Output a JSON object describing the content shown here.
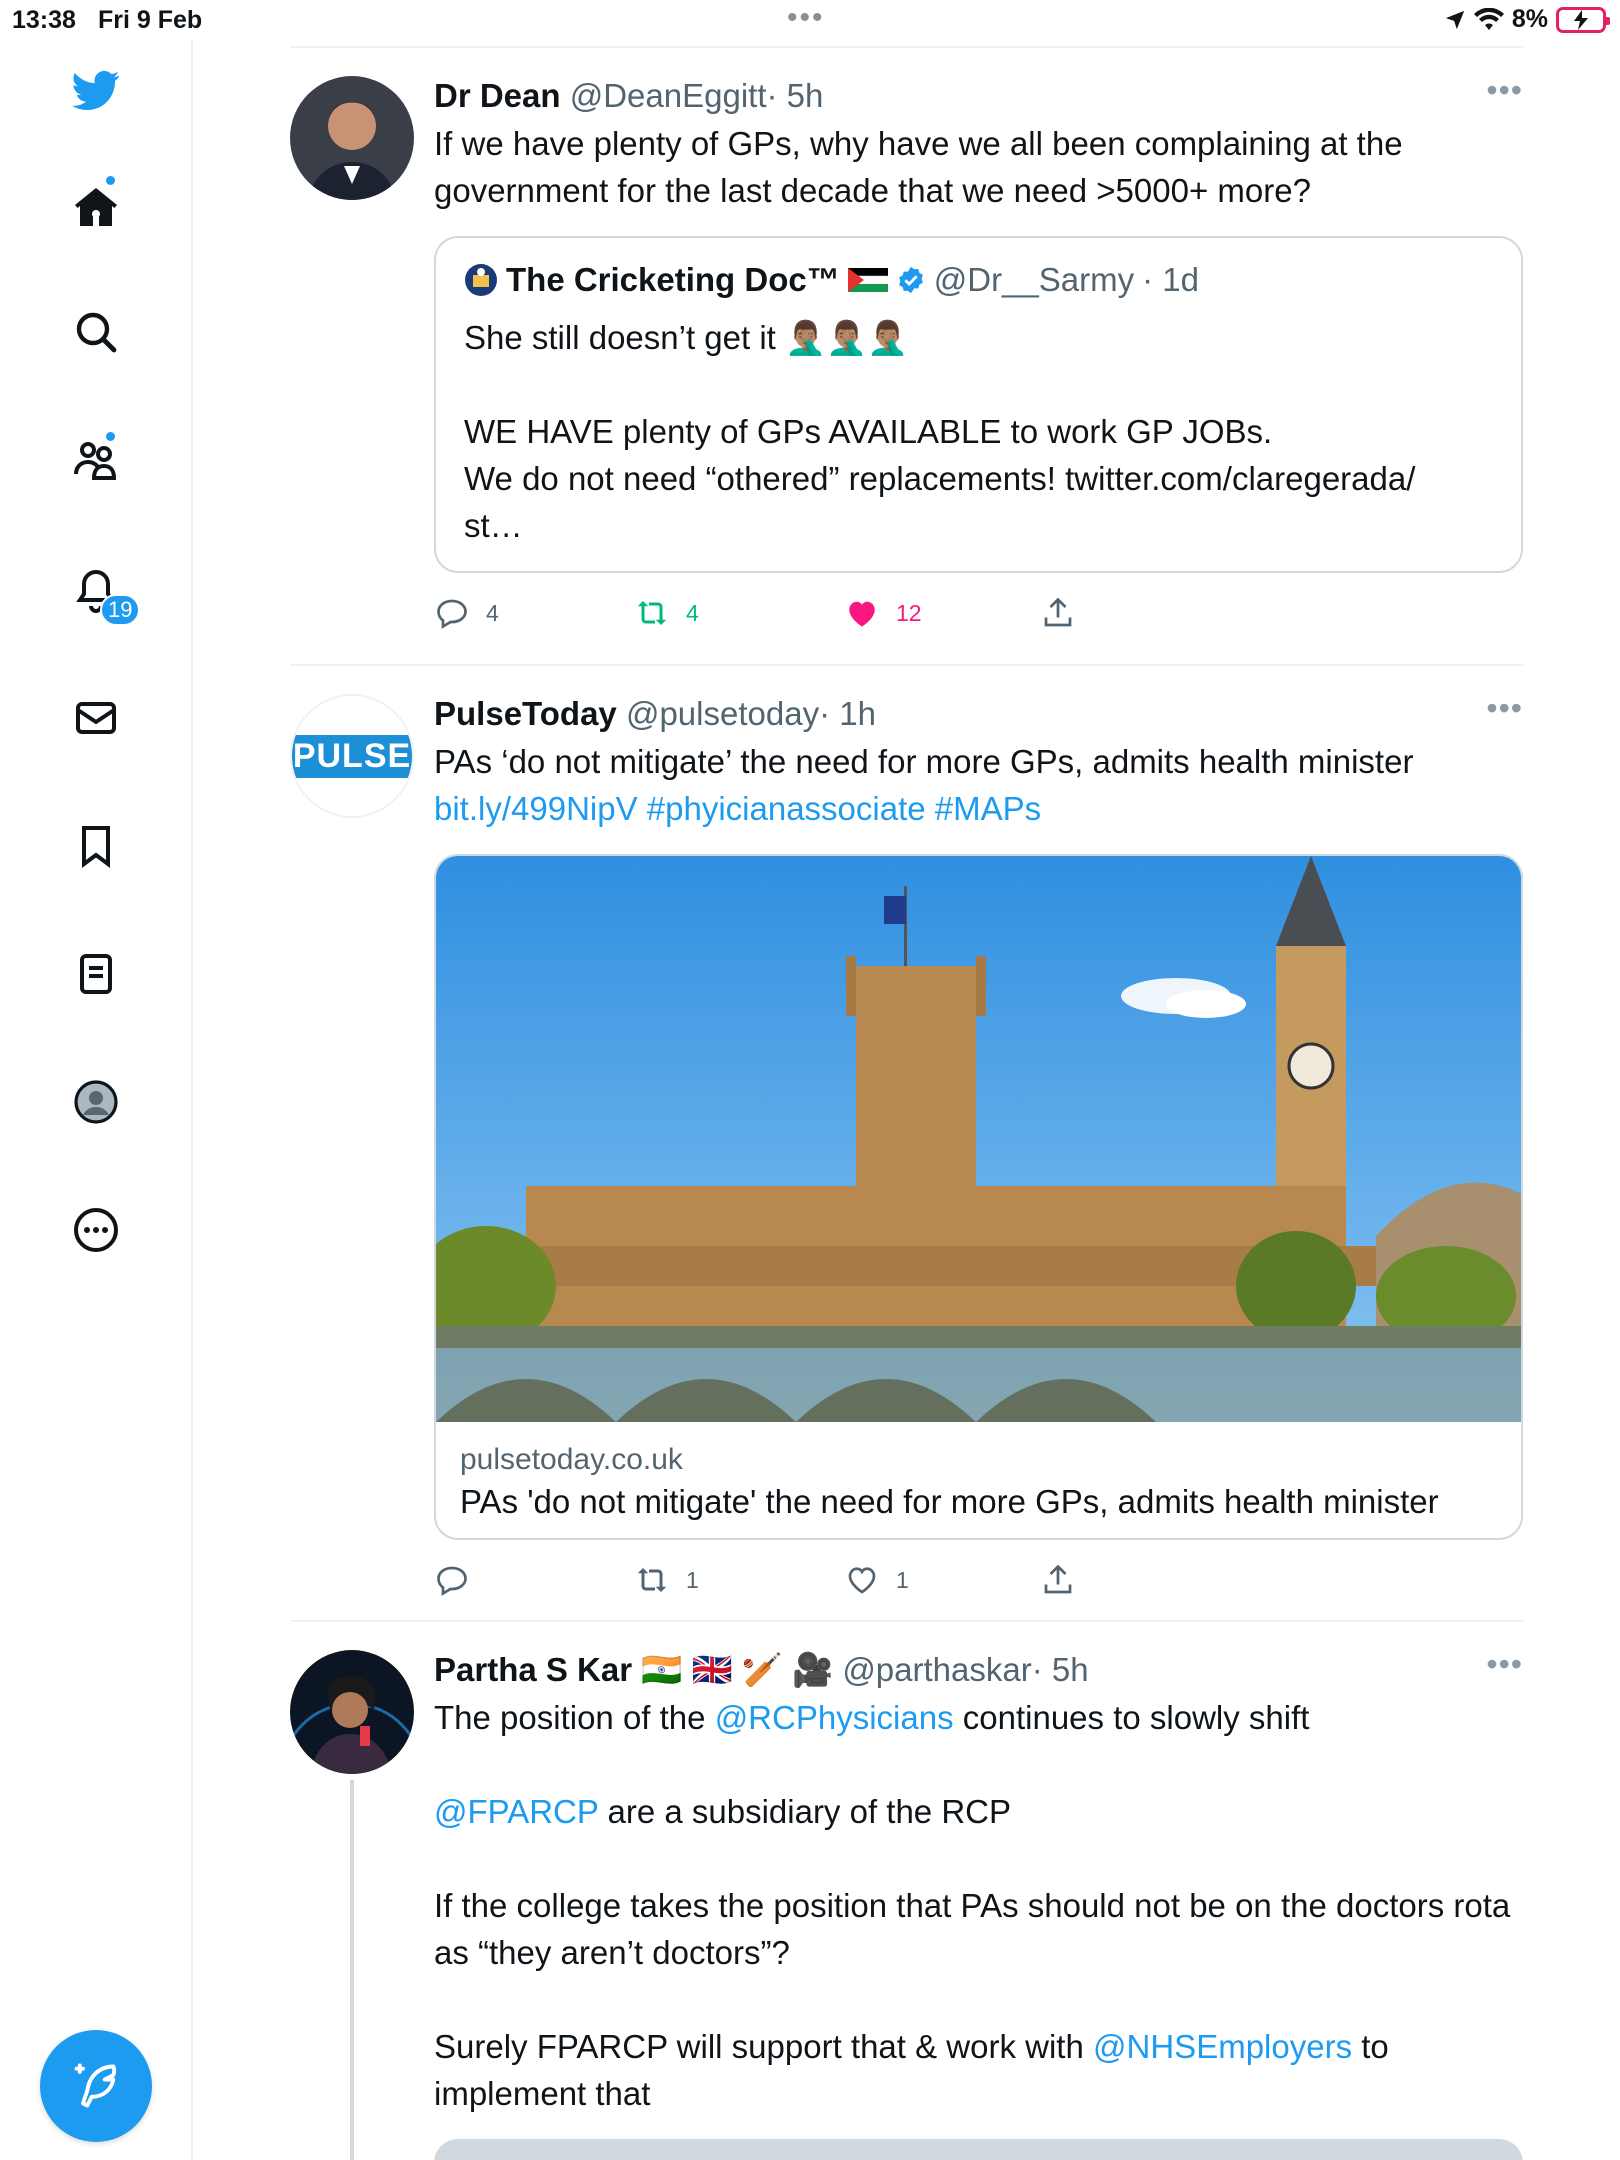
{
  "status_bar": {
    "time": "13:38",
    "date": "Fri 9 Feb",
    "battery": "8%"
  },
  "sidebar": {
    "notification_count": "19",
    "items": [
      {
        "name": "home",
        "icon": "home-icon"
      },
      {
        "name": "explore",
        "icon": "search-icon"
      },
      {
        "name": "communities",
        "icon": "communities-icon"
      },
      {
        "name": "notifications",
        "icon": "bell-icon"
      },
      {
        "name": "messages",
        "icon": "envelope-icon"
      },
      {
        "name": "bookmarks",
        "icon": "bookmark-icon"
      },
      {
        "name": "lists",
        "icon": "list-icon"
      },
      {
        "name": "profile",
        "icon": "profile-icon"
      },
      {
        "name": "more",
        "icon": "more-circle-icon"
      }
    ]
  },
  "tweets": [
    {
      "name": "Dr Dean",
      "handle": "@DeanEggitt",
      "time": "· 5h",
      "text": "If we have plenty of GPs, why have we all been complaining at the government for the last decade that we need >5000+ more?",
      "quote": {
        "name": "The Cricketing Doc™",
        "handle": "@Dr__Sarmy",
        "time": "· 1d",
        "text_line1": "She still doesn’t get it 🤦🏽‍♂️🤦🏽‍♂️🤦🏽‍♂️",
        "text_rest": "WE HAVE plenty of GPs AVAILABLE to work GP JOBs.\nWe do not need “othered” replacements! twitter.com/claregerada/\nst…"
      },
      "replies": "4",
      "retweets": "4",
      "likes": "12"
    },
    {
      "name": "PulseToday",
      "handle": "@pulsetoday",
      "time": "· 1h",
      "avatar_text": "PULSE",
      "text": "PAs ‘do not mitigate’ the need for more GPs, admits health minister",
      "link": "bit.ly/499NipV #phyicianassociate #MAPs",
      "card_domain": "pulsetoday.co.uk",
      "card_title": "PAs 'do not mitigate' the need for more GPs, admits health minister",
      "replies": "",
      "retweets": "1",
      "likes": "1"
    },
    {
      "name": "Partha S Kar",
      "flags": "🇮🇳 🇬🇧 🏏 🎥",
      "handle": "@parthaskar",
      "time": "· 5h",
      "p1_pre": "The position of the ",
      "p1_link": "@RCPhysicians",
      "p1_post": " continues to slowly shift",
      "p2_link": "@FPARCP",
      "p2_post": " are a subsidiary of the RCP",
      "p3": "If the college takes the position that PAs should not be on the doctors rota as “they aren’t doctors”?",
      "p4_pre": "Surely FPARCP will support that & work with ",
      "p4_link": "@NHSEmployers",
      "p4_post": " to implement that"
    }
  ],
  "colors": {
    "accent": "#1d9bf0",
    "retweet": "#00ba7c",
    "like": "#f91880",
    "text": "#0f1419",
    "muted": "#536471"
  }
}
